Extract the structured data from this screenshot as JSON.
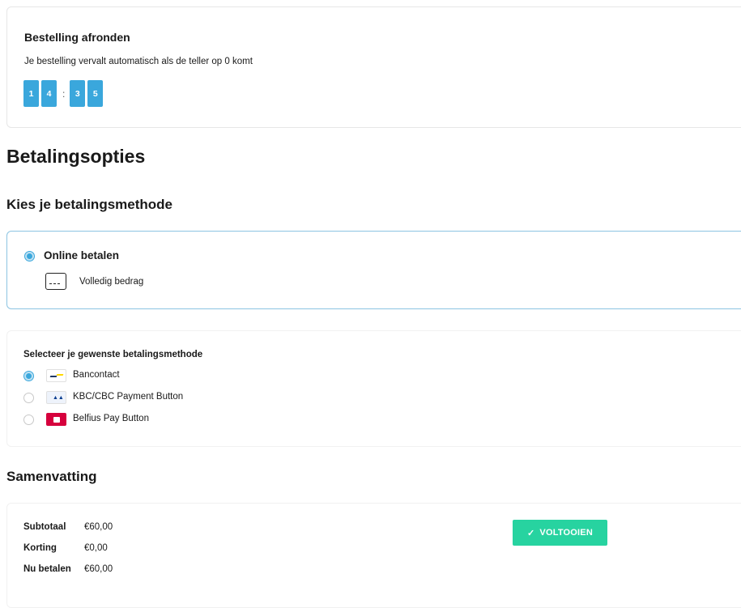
{
  "order": {
    "title": "Bestelling afronden",
    "subtitle": "Je bestelling vervalt automatisch als de teller op 0 komt",
    "timer": {
      "digits": [
        "1",
        "4",
        "3",
        "5"
      ],
      "separator": ":"
    }
  },
  "payment": {
    "heading": "Betalingsopties",
    "subheading": "Kies je betalingsmethode",
    "method": {
      "title": "Online betalen",
      "description": "Volledig bedrag"
    },
    "select_title": "Selecteer je gewenste betalingsmethode",
    "options": [
      {
        "label": "Bancontact",
        "selected": true
      },
      {
        "label": "KBC/CBC Payment Button",
        "selected": false
      },
      {
        "label": "Belfius Pay Button",
        "selected": false
      }
    ]
  },
  "summary": {
    "heading": "Samenvatting",
    "rows": [
      {
        "key": "Subtotaal",
        "value": "€60,00"
      },
      {
        "key": "Korting",
        "value": "€0,00"
      },
      {
        "key": "Nu betalen",
        "value": "€60,00"
      }
    ],
    "complete_label": "VOLTOOIEN"
  },
  "colors": {
    "accent": "#3aa7dc",
    "success": "#27d3a0",
    "belfius": "#d6003d"
  }
}
